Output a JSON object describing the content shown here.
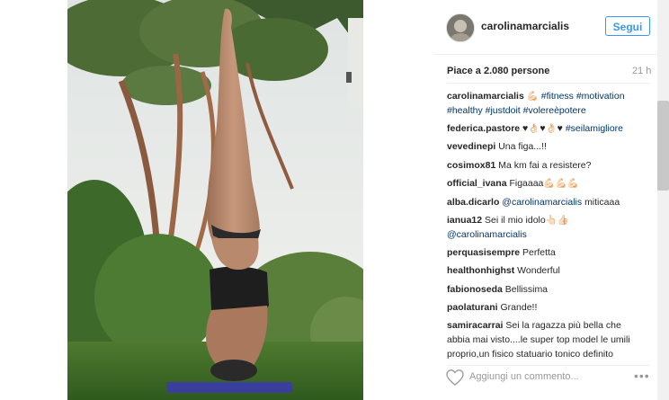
{
  "post": {
    "username": "carolinamarcialis",
    "follow_label": "Segui",
    "likes": "Piace a 2.080 persone",
    "time": "21 h"
  },
  "comments": [
    {
      "user": "carolinamarcialis",
      "text": "💪🏻",
      "tags": "#fitness #motivation #healthy #justdoit #volereèpotere"
    },
    {
      "user": "federica.pastore",
      "text": "♥👌🏻♥👌🏻♥",
      "tags": "#seilamigliore"
    },
    {
      "user": "vevedinepi",
      "text": "Una figa...!!"
    },
    {
      "user": "cosimox81",
      "text": "Ma km fai a resistere?"
    },
    {
      "user": "official_ivana",
      "text": "Figaaaa💪🏻💪🏻💪🏻"
    },
    {
      "user": "alba.dicarlo",
      "mention": "@carolinamarcialis",
      "text": "miticaaa"
    },
    {
      "user": "ianua12",
      "text": "Sei il mio idolo👆🏻👍🏻",
      "mention": "@carolinamarcialis"
    },
    {
      "user": "perquasisempre",
      "text": "Perfetta"
    },
    {
      "user": "healthonhighst",
      "text": "Wonderful"
    },
    {
      "user": "fabionoseda",
      "text": "Bellissima"
    },
    {
      "user": "paolaturani",
      "text": "Grande!!"
    },
    {
      "user": "samiracarrai",
      "text": "Sei la ragazza più bella che abbia mai visto....le super top model le umili proprio,un fisico statuario tonico definito super sportivo.....sei strepitosa!!!!"
    }
  ],
  "add_comment_placeholder": "Aggiungi un commento...",
  "more_label": "•••",
  "colors": {
    "accent": "#3897f0",
    "link": "#003569"
  }
}
